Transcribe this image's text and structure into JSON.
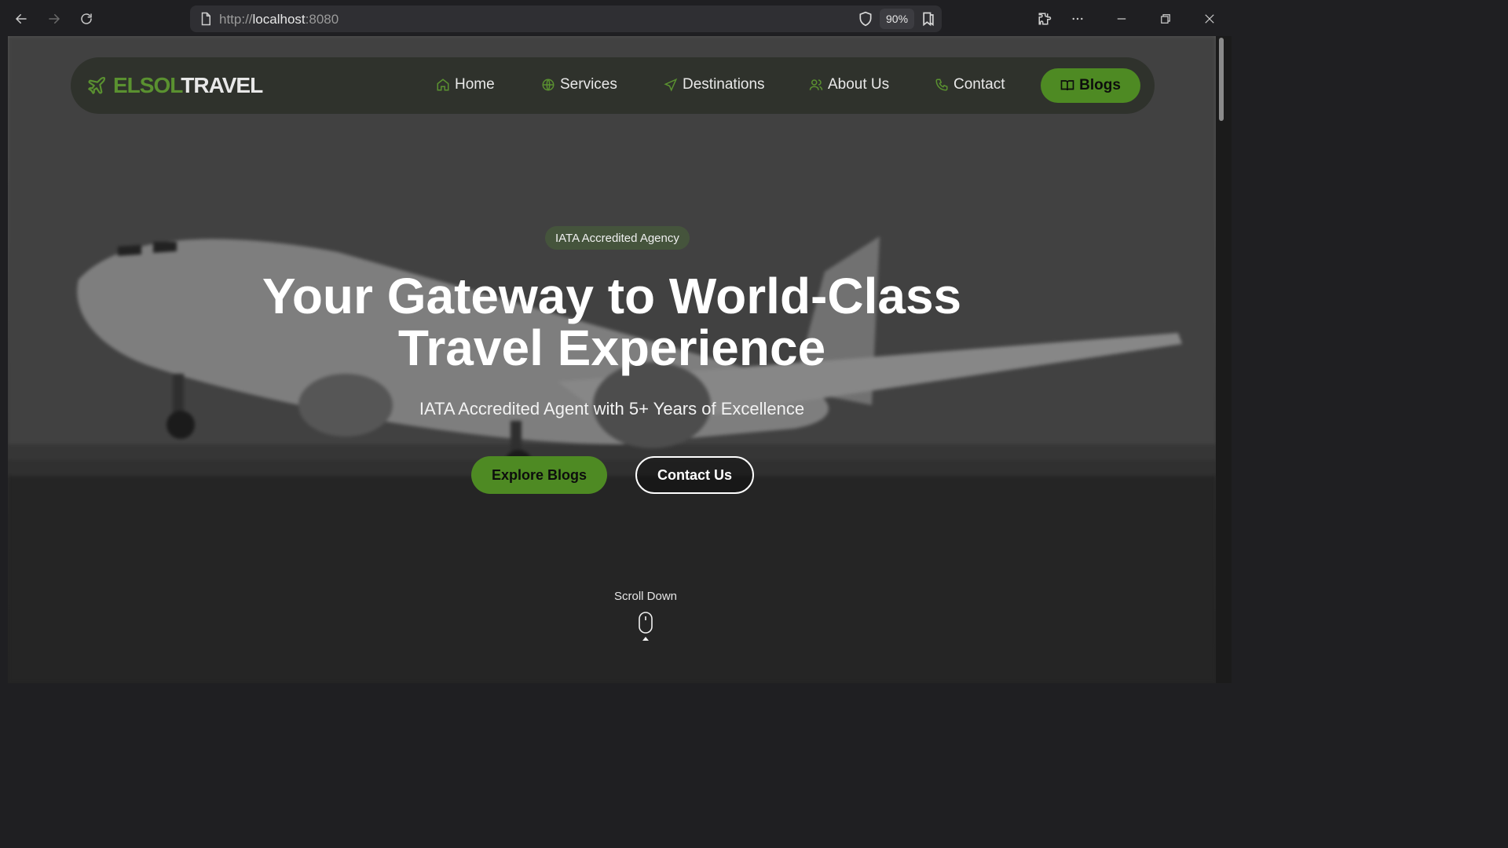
{
  "browser": {
    "url_scheme": "http://",
    "url_host": "localhost",
    "url_port": ":8080",
    "zoom": "90%",
    "icons": [
      "back-arrow-icon",
      "forward-arrow-icon",
      "reload-icon",
      "page-icon",
      "shield-icon",
      "reader-icon",
      "extensions-icon",
      "more-icon",
      "minimize-icon",
      "restore-icon",
      "close-icon"
    ]
  },
  "site": {
    "logo_part1": "ELSOL",
    "logo_part2": "TRAVEL",
    "brand_color": "#4e8a23",
    "nav": [
      {
        "label": "Home",
        "icon": "home-icon"
      },
      {
        "label": "Services",
        "icon": "globe-icon"
      },
      {
        "label": "Destinations",
        "icon": "send-icon"
      },
      {
        "label": "About Us",
        "icon": "users-icon"
      },
      {
        "label": "Contact",
        "icon": "phone-icon"
      }
    ],
    "cta": {
      "label": "Blogs",
      "icon": "book-icon"
    }
  },
  "hero": {
    "badge": "IATA Accredited Agency",
    "title_line1": "Your Gateway to World-Class",
    "title_line2": "Travel Experience",
    "subtitle": "IATA Accredited Agent with 5+ Years of Excellence",
    "primary_button": "Explore Blogs",
    "secondary_button": "Contact Us",
    "scroll_label": "Scroll Down"
  }
}
